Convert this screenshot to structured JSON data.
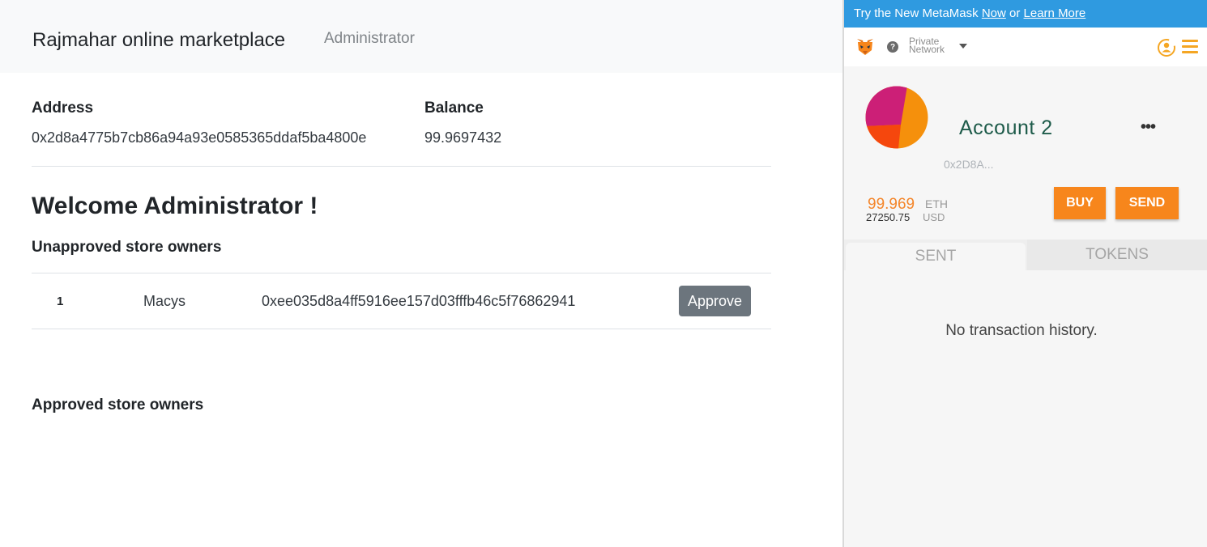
{
  "navbar": {
    "brand": "Rajmahar online marketplace",
    "role": "Administrator"
  },
  "account": {
    "address_label": "Address",
    "address_value": "0x2d8a4775b7cb86a94a93e0585365ddaf5ba4800e",
    "balance_label": "Balance",
    "balance_value": "99.9697432"
  },
  "welcome": "Welcome Administrator !",
  "unapproved": {
    "heading": "Unapproved store owners",
    "rows": [
      {
        "num": "1",
        "name": "Macys",
        "address": "0xee035d8a4ff5916ee157d03fffb46c5f76862941",
        "action": "Approve"
      }
    ]
  },
  "approved": {
    "heading": "Approved store owners"
  },
  "metamask": {
    "banner": {
      "prefix": "Try the New MetaMask ",
      "now": "Now",
      "middle": " or ",
      "learn": "Learn More"
    },
    "network_line1": "Private",
    "network_line2": "Network",
    "help": "?",
    "account_name": "Account 2",
    "account_menu": "•••",
    "short_address": "0x2D8A...",
    "eth_amount": "99.969",
    "eth_unit": "ETH",
    "usd_amount": "27250.75",
    "usd_unit": "USD",
    "buy_label": "BUY",
    "send_label": "SEND",
    "tabs": [
      "SENT",
      "TOKENS"
    ],
    "empty_message": "No transaction history.",
    "colors": {
      "accent": "#f7861c",
      "banner": "#2f9ae0",
      "account_name": "#1e5b4a"
    }
  }
}
